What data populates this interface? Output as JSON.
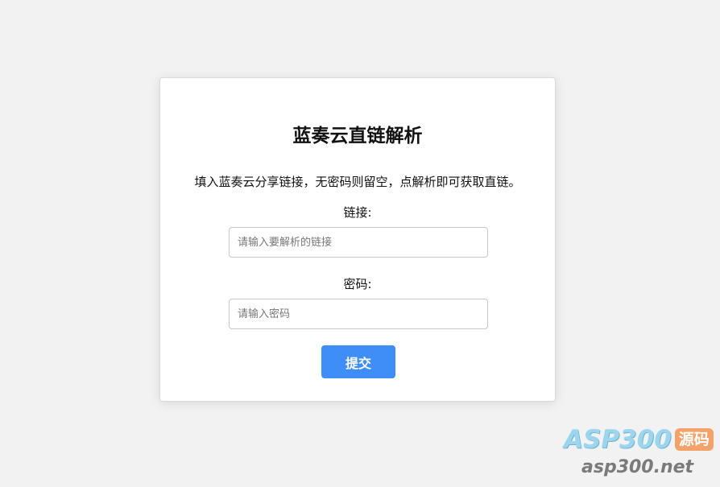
{
  "form": {
    "title": "蓝奏云直链解析",
    "description": "填入蓝奏云分享链接，无密码则留空，点解析即可获取直链。",
    "link_label": "链接:",
    "link_placeholder": "请输入要解析的链接",
    "link_value": "",
    "password_label": "密码:",
    "password_placeholder": "请输入密码",
    "password_value": "",
    "submit_label": "提交"
  },
  "watermark": {
    "brand": "ASP300",
    "badge": "源码",
    "url": "asp300.net"
  },
  "colors": {
    "background": "#f2f2f2",
    "card": "#ffffff",
    "button": "#3f8ef7",
    "watermark_badge": "#f3a36a"
  }
}
